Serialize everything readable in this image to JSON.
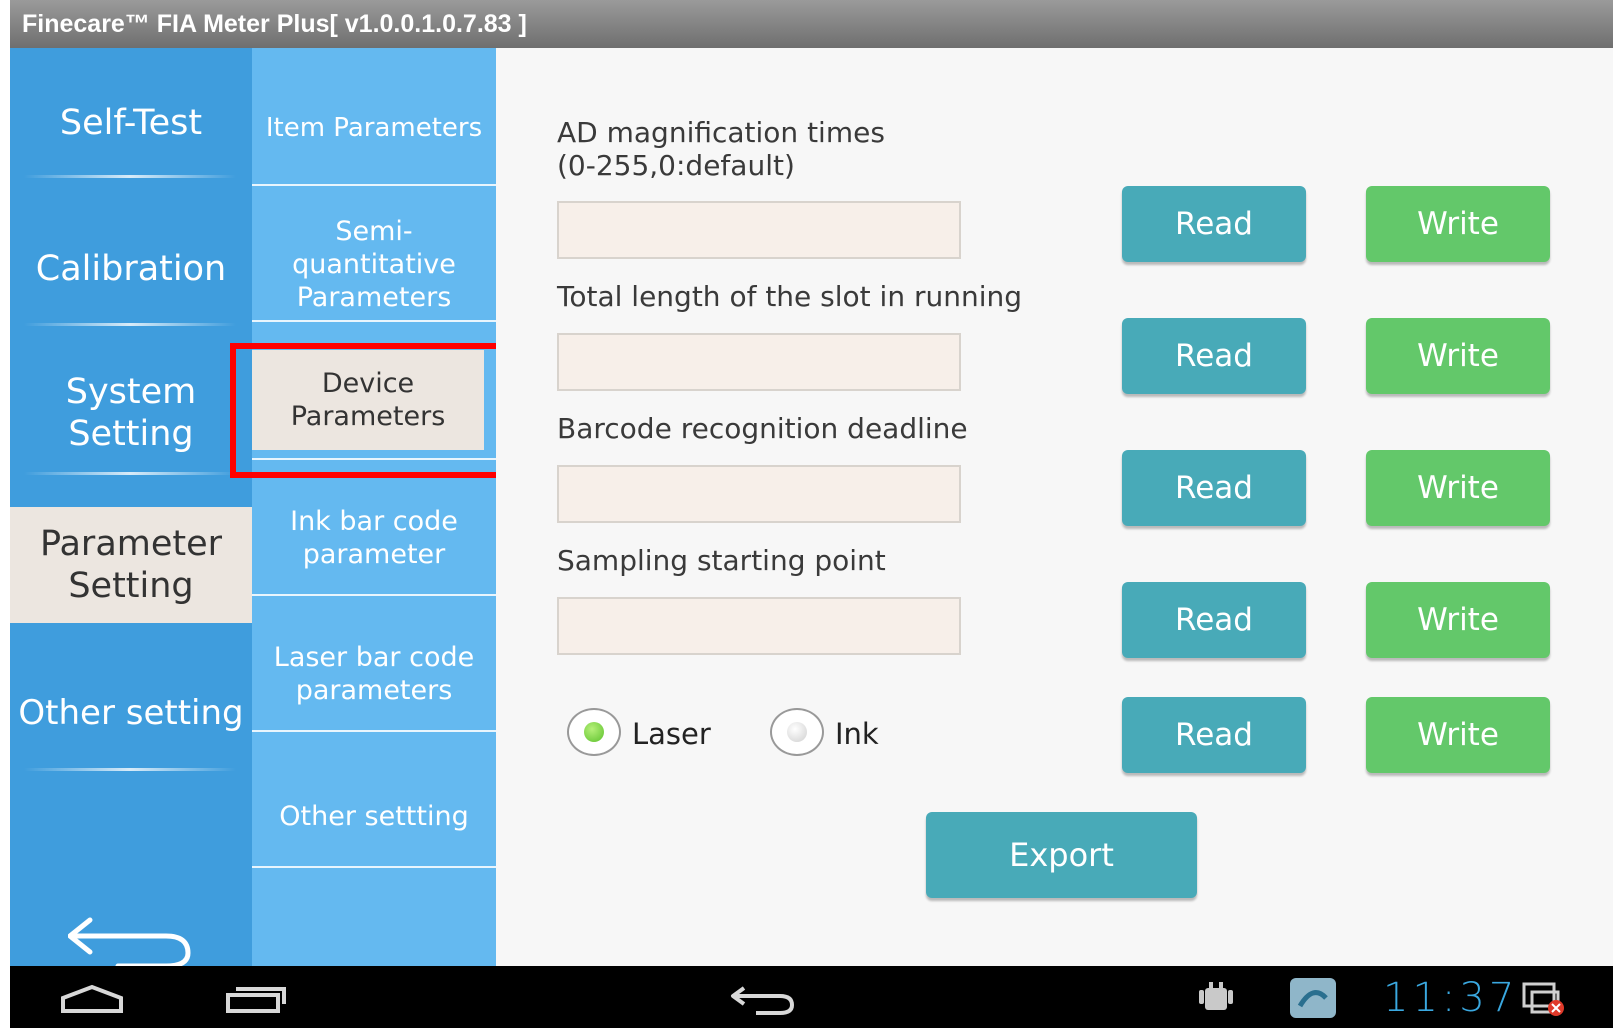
{
  "window": {
    "title": "Finecare™ FIA Meter Plus[ v1.0.0.1.0.7.83 ]"
  },
  "main_nav": {
    "items": [
      {
        "label": "Self-Test"
      },
      {
        "label": "Calibration"
      },
      {
        "label": "System Setting"
      },
      {
        "label": "Parameter Setting",
        "active": true
      },
      {
        "label": "Other setting"
      }
    ],
    "back_icon": "back-arrow-icon"
  },
  "sub_nav": {
    "items": [
      {
        "label": "Item Parameters"
      },
      {
        "label": "Semi-quantitative Parameters"
      },
      {
        "label": "Device Parameters",
        "active": true
      },
      {
        "label": "Ink bar code parameter"
      },
      {
        "label": "Laser bar code parameters"
      },
      {
        "label": "Other settting"
      }
    ]
  },
  "form": {
    "fields": [
      {
        "label": "AD magnification times (0-255,0:default)",
        "value": ""
      },
      {
        "label": "Total length of the slot in running",
        "value": ""
      },
      {
        "label": "Barcode recognition deadline",
        "value": ""
      },
      {
        "label": "Sampling starting point",
        "value": ""
      }
    ],
    "read_label": "Read",
    "write_label": "Write",
    "radio": {
      "laser_label": "Laser",
      "ink_label": "Ink",
      "selected": "Laser"
    },
    "export_label": "Export"
  },
  "system_bar": {
    "time": "11:37",
    "icons": [
      "home-icon",
      "recent-apps-icon",
      "back-icon",
      "android-debug-icon",
      "app-notification-icon",
      "screenshot-icon"
    ]
  },
  "colors": {
    "main_nav_bg": "#3f9ddd",
    "sub_nav_bg": "#64b9f0",
    "read_button": "#48aab8",
    "write_button": "#63c86a",
    "highlight": "#ff0000",
    "clock": "#3aa8e0"
  }
}
